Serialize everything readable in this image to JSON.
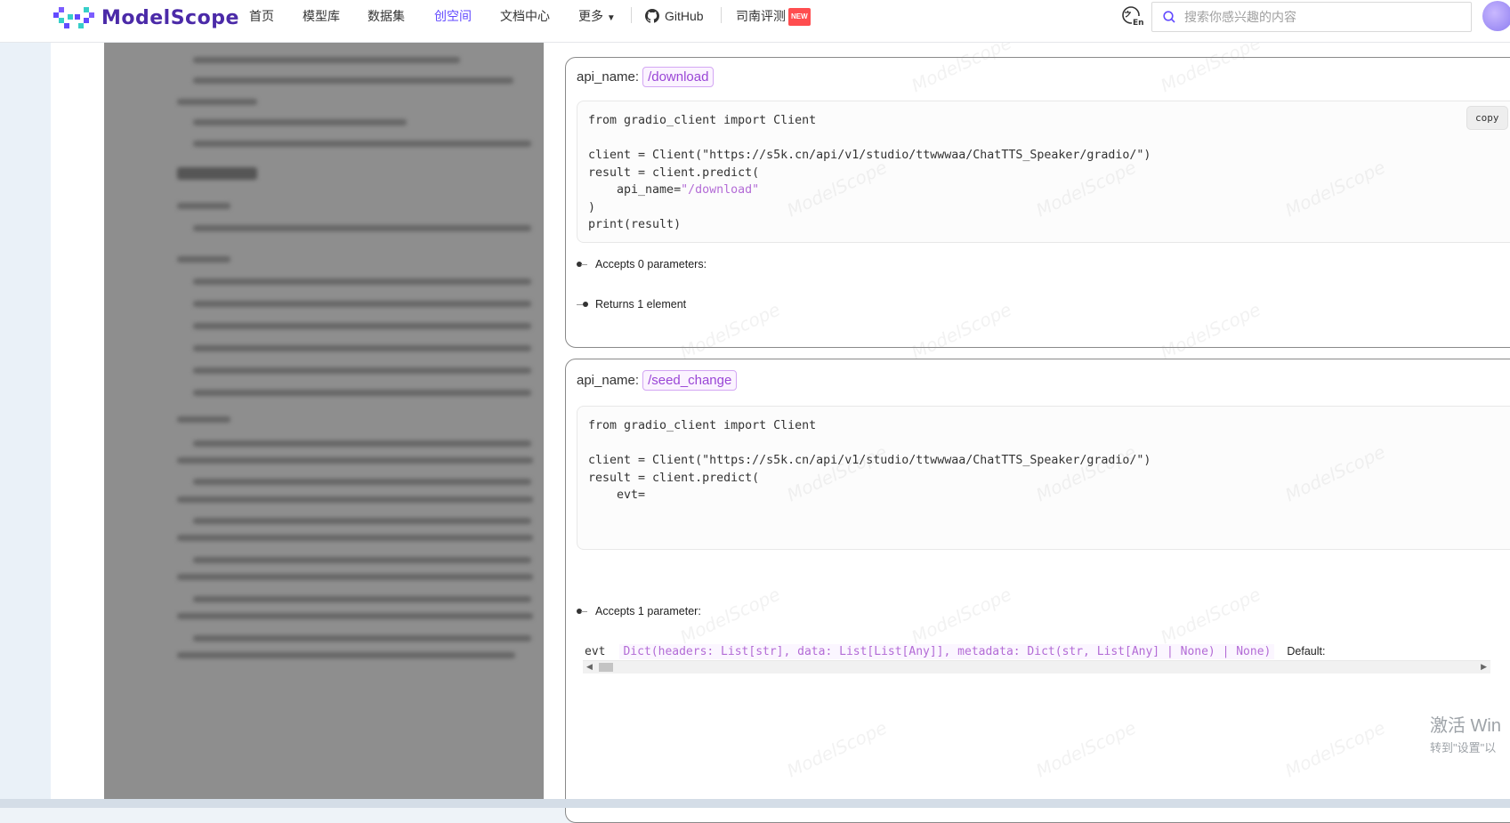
{
  "brand": {
    "logo_text": "ModelScope"
  },
  "nav": {
    "items": [
      "首页",
      "模型库",
      "数据集",
      "创空间",
      "文档中心",
      "更多"
    ],
    "active": "创空间",
    "github": "GitHub",
    "evaluation": "司南评测",
    "new_badge": "NEW"
  },
  "search": {
    "placeholder": "搜索你感兴趣的内容"
  },
  "blocks": [
    {
      "api_label": "api_name:",
      "api_name": "/download",
      "copy_label": "copy",
      "code": {
        "line1": "from gradio_client import Client",
        "line2": "client = Client(\"https://s5k.cn/api/v1/studio/ttwwwaa/ChatTTS_Speaker/gradio/\")",
        "line3": "result = client.predict(",
        "line4_key": "    api_name=",
        "line4_val": "\"/download\"",
        "line5": ")",
        "line6": "print(result)"
      },
      "accepts": "Accepts 0 parameters:",
      "returns": "Returns 1 element"
    },
    {
      "api_label": "api_name:",
      "api_name": "/seed_change",
      "code": {
        "line1": "from gradio_client import Client",
        "line2": "client = Client(\"https://s5k.cn/api/v1/studio/ttwwwaa/ChatTTS_Speaker/gradio/\")",
        "line3": "result = client.predict(",
        "line4": "    evt="
      },
      "accepts": "Accepts 1 parameter:",
      "param": {
        "name": "evt",
        "type": "Dict(headers: List[str], data: List[List[Any]], metadata: Dict(str, List[Any] | None) | None)",
        "default_label": "Default:"
      }
    }
  ],
  "windows_activation": {
    "line1": "激活 Win",
    "line2": "转到\"设置\"以"
  },
  "watermark": "ModelScope",
  "colors": {
    "accent": "#624aff",
    "tag": "#9a46d6",
    "string": "#b36bd6"
  }
}
